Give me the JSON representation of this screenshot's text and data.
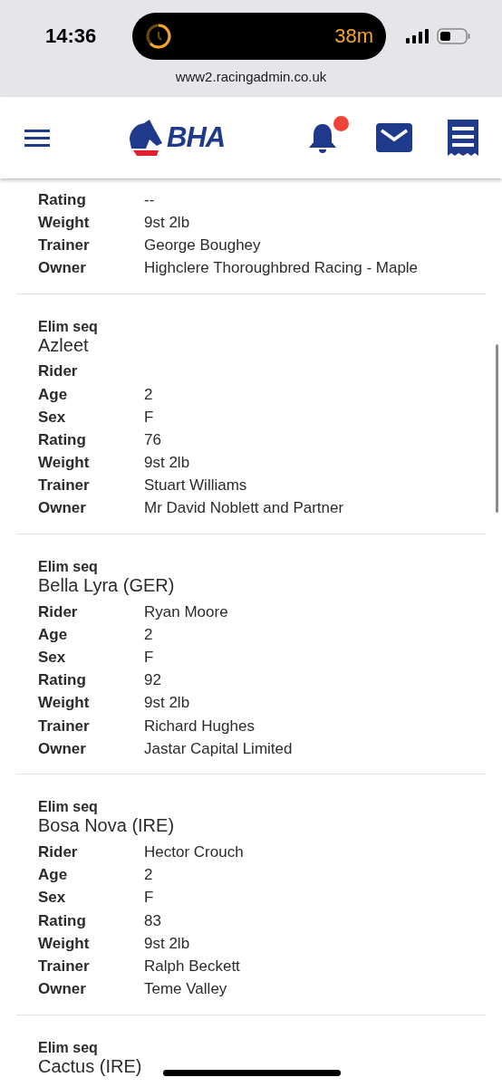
{
  "status_bar": {
    "time": "14:36",
    "activity": "38m"
  },
  "address_bar": {
    "url": "www2.racingadmin.co.uk"
  },
  "header": {
    "logo_text": "BHA",
    "has_notifications": true
  },
  "entries": [
    {
      "fields": [
        {
          "label": "Rating",
          "value": "--"
        },
        {
          "label": "Weight",
          "value": "9st 2lb"
        },
        {
          "label": "Trainer",
          "value": "George Boughey"
        },
        {
          "label": "Owner",
          "value": "Highclere Thoroughbred Racing - Maple"
        }
      ]
    },
    {
      "elim_label": "Elim seq",
      "name": "Azleet",
      "fields": [
        {
          "label": "Rider"
        },
        {
          "label": "Age",
          "value": "2"
        },
        {
          "label": "Sex",
          "value": "F"
        },
        {
          "label": "Rating",
          "value": "76"
        },
        {
          "label": "Weight",
          "value": "9st 2lb"
        },
        {
          "label": "Trainer",
          "value": "Stuart Williams"
        },
        {
          "label": "Owner",
          "value": "Mr David Noblett and Partner"
        }
      ]
    },
    {
      "elim_label": "Elim seq",
      "name": "Bella Lyra (GER)",
      "fields": [
        {
          "label": "Rider",
          "value": "Ryan Moore"
        },
        {
          "label": "Age",
          "value": "2"
        },
        {
          "label": "Sex",
          "value": "F"
        },
        {
          "label": "Rating",
          "value": "92"
        },
        {
          "label": "Weight",
          "value": "9st 2lb"
        },
        {
          "label": "Trainer",
          "value": "Richard Hughes"
        },
        {
          "label": "Owner",
          "value": "Jastar Capital Limited"
        }
      ]
    },
    {
      "elim_label": "Elim seq",
      "name": "Bosa Nova (IRE)",
      "fields": [
        {
          "label": "Rider",
          "value": "Hector Crouch"
        },
        {
          "label": "Age",
          "value": "2"
        },
        {
          "label": "Sex",
          "value": "F"
        },
        {
          "label": "Rating",
          "value": "83"
        },
        {
          "label": "Weight",
          "value": "9st 2lb"
        },
        {
          "label": "Trainer",
          "value": "Ralph Beckett"
        },
        {
          "label": "Owner",
          "value": "Teme Valley"
        }
      ]
    },
    {
      "elim_label": "Elim seq",
      "name": "Cactus (IRE)"
    }
  ]
}
